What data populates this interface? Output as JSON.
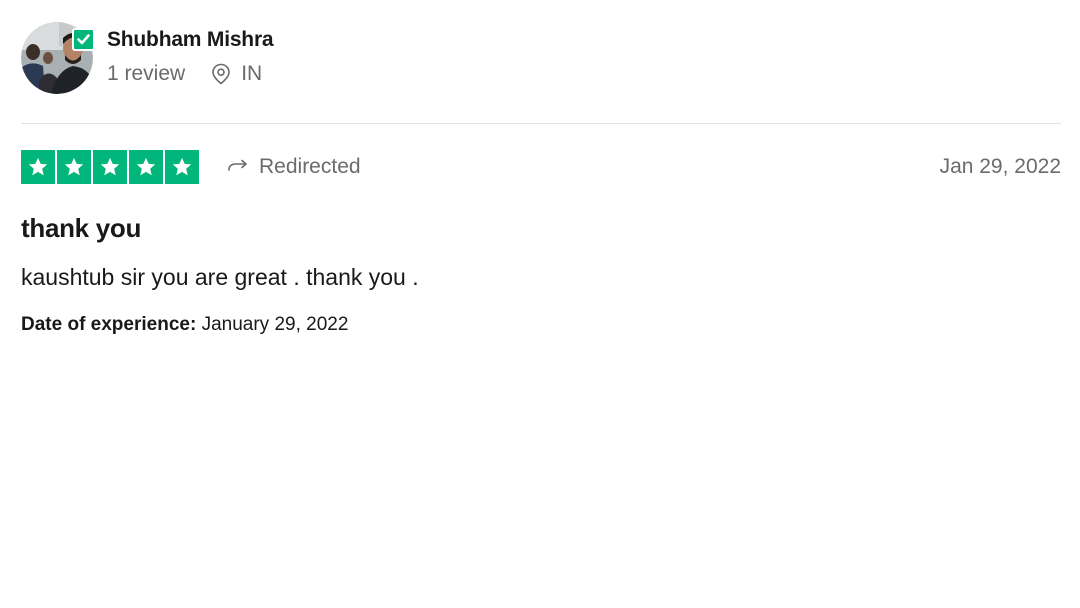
{
  "consumer": {
    "name": "Shubham Mishra",
    "review_count": "1 review",
    "country": "IN",
    "verified_icon": "check-icon",
    "location_icon": "location-pin-icon"
  },
  "review": {
    "rating_stars": 5,
    "rating_max": 5,
    "source_label": "Redirected",
    "source_icon": "redirect-arrow-icon",
    "date": "Jan 29, 2022",
    "title": "thank you",
    "body": "kaushtub sir you are great . thank you .",
    "experience_label": "Date of experience:",
    "experience_date": "January 29, 2022"
  },
  "colors": {
    "star_green": "#00b67a",
    "text_primary": "#191919",
    "text_secondary": "#6b6b6b",
    "divider": "#e3e3e3"
  }
}
